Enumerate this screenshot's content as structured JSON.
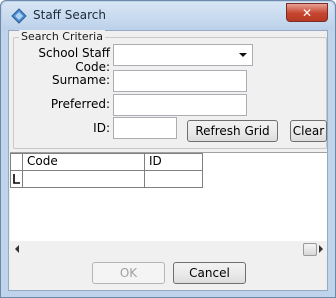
{
  "window": {
    "title": "Staff Search",
    "close_symbol": "✕"
  },
  "search": {
    "group_title": "Search Criteria",
    "staff_code_label": "School Staff Code:",
    "staff_code_value": "",
    "surname_label": "Surname:",
    "surname_value": "",
    "preferred_label": "Preferred:",
    "preferred_value": "",
    "id_label": "ID:",
    "id_value": "",
    "refresh_label": "Refresh Grid",
    "clear_label": "Clear"
  },
  "grid": {
    "columns": [
      "Code",
      "ID"
    ],
    "rows": [
      [
        "",
        ""
      ]
    ]
  },
  "footer": {
    "ok_label": "OK",
    "cancel_label": "Cancel"
  }
}
